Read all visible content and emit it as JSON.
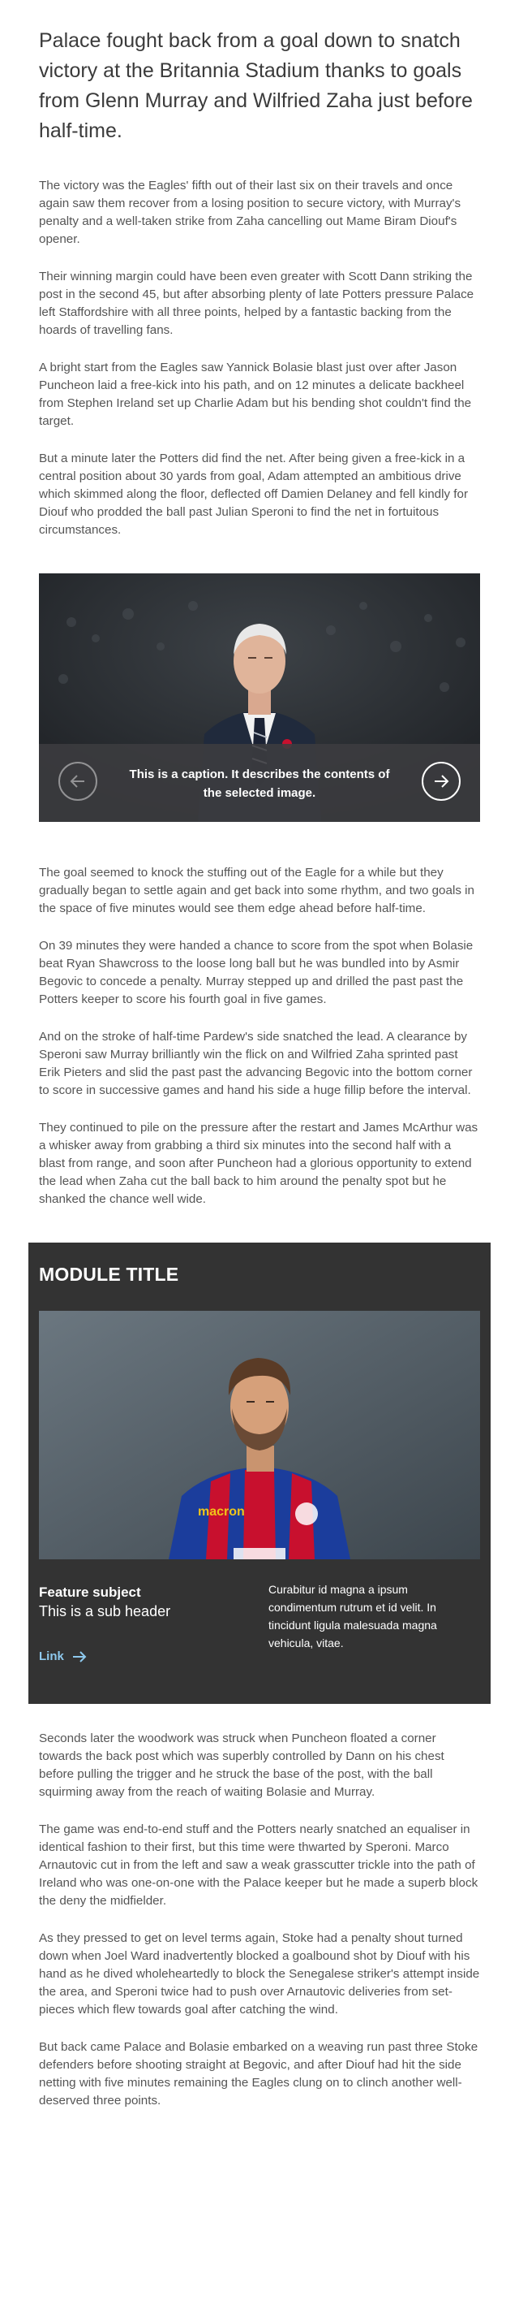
{
  "article": {
    "lead": "Palace fought back from a goal down to snatch victory at the Britannia Stadium thanks to goals from Glenn Murray and Wilfried Zaha just before half-time.",
    "paragraphs_a": [
      "The victory was the Eagles' fifth out of their last six on their travels and once again saw them recover from a losing position to secure victory, with Murray's penalty and a well-taken strike from Zaha cancelling out Mame Biram Diouf's opener.",
      "Their winning margin could have been even greater with Scott Dann striking the post in the second 45, but after absorbing plenty of late Potters pressure Palace left Staffordshire with all three points, helped by a fantastic backing from the hoards of travelling fans.",
      "A bright start from the Eagles saw Yannick Bolasie blast just over after Jason Puncheon laid a free-kick into his path, and on 12 minutes a delicate backheel from Stephen Ireland set up Charlie Adam but his bending shot couldn't find the target.",
      "But a minute later the Potters did find the net. After being given a free-kick in a central position about 30 yards from goal, Adam attempted an ambitious drive which skimmed along the floor, deflected off Damien Delaney and fell kindly for Diouf who prodded the ball past Julian Speroni to find the net in fortuitous circumstances."
    ],
    "paragraphs_b": [
      "The goal seemed to knock the stuffing out of the Eagle for a while but they gradually began to settle again and get back into some rhythm, and two goals in the space of five minutes would see them edge ahead before half-time.",
      "On 39 minutes they were handed a chance to score from the spot when Bolasie beat Ryan Shawcross to the loose long ball but he was bundled into by Asmir Begovic to concede a penalty. Murray stepped up and drilled the past past the Potters keeper to score his fourth goal in five games.",
      "And on the stroke of half-time Pardew's side snatched the lead. A clearance by Speroni saw Murray brilliantly win the flick on and Wilfried Zaha sprinted past Erik Pieters and slid the past past the advancing Begovic into the bottom corner to score in successive games and hand his side a huge fillip before the interval.",
      "They continued to pile on the pressure after the restart and James McArthur was a whisker away from grabbing a third six minutes into the second half with a blast from range, and soon after Puncheon had a glorious opportunity to extend the lead when Zaha cut the ball back to him around the penalty spot but he shanked the chance well wide."
    ],
    "paragraphs_c": [
      "Seconds later the woodwork was struck when Puncheon floated a corner towards the back post which was superbly controlled by Dann on his chest before pulling the trigger and he struck the base of the post, with the ball squirming away from the reach of waiting Bolasie and Murray.",
      "The game was end-to-end stuff and the Potters nearly snatched an equaliser in identical fashion to their first, but this time were thwarted by Speroni. Marco Arnautovic cut in from the left and saw a weak grasscutter trickle into the path of Ireland who was one-on-one with the Palace keeper but he made a superb block the deny the midfielder.",
      "As they pressed to get on level terms again, Stoke had a penalty shout turned down when Joel Ward inadvertently blocked a goalbound shot by Diouf with his hand as he dived wholeheartedly to block the Senegalese striker's attempt inside the area, and Speroni twice had to push over Arnautovic deliveries from set-pieces which flew towards goal after catching the wind.",
      "But back came Palace and Bolasie embarked on a weaving run past three Stoke defenders before shooting straight at Begovic, and after Diouf had hit the side netting with five minutes remaining the Eagles clung on to clinch another well-deserved three points."
    ]
  },
  "gallery": {
    "caption": "This is a caption. It describes the contents of the selected image.",
    "prev_icon": "arrow-left-circle-icon",
    "next_icon": "arrow-right-circle-icon"
  },
  "module": {
    "title": "MODULE TITLE",
    "subject": "Feature subject",
    "subheader": "This is a sub header",
    "link_label": "Link",
    "link_icon": "arrow-right-icon",
    "body": "Curabitur id magna a ipsum condimentum rutrum et id velit. In tincidunt ligula malesuada magna vehicula, vitae.",
    "jersey_brand": "macron",
    "colors": {
      "bg": "#333333",
      "link": "#8ec9ee"
    }
  }
}
